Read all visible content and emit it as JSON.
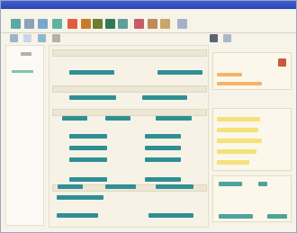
{
  "colors": {
    "accent": "#2b46b3",
    "chip": "#2f8f93",
    "highlight_orange": "#f4b46b",
    "highlight_yellow": "#f5e17a"
  },
  "toolbar": {
    "icons": [
      "app-icon",
      "new-file-icon",
      "open-folder-icon",
      "save-icon",
      "cut-icon",
      "copy-icon",
      "paste-icon",
      "undo-icon",
      "redo-icon",
      "print-icon",
      "find-icon",
      "settings-icon",
      "help-icon"
    ]
  }
}
